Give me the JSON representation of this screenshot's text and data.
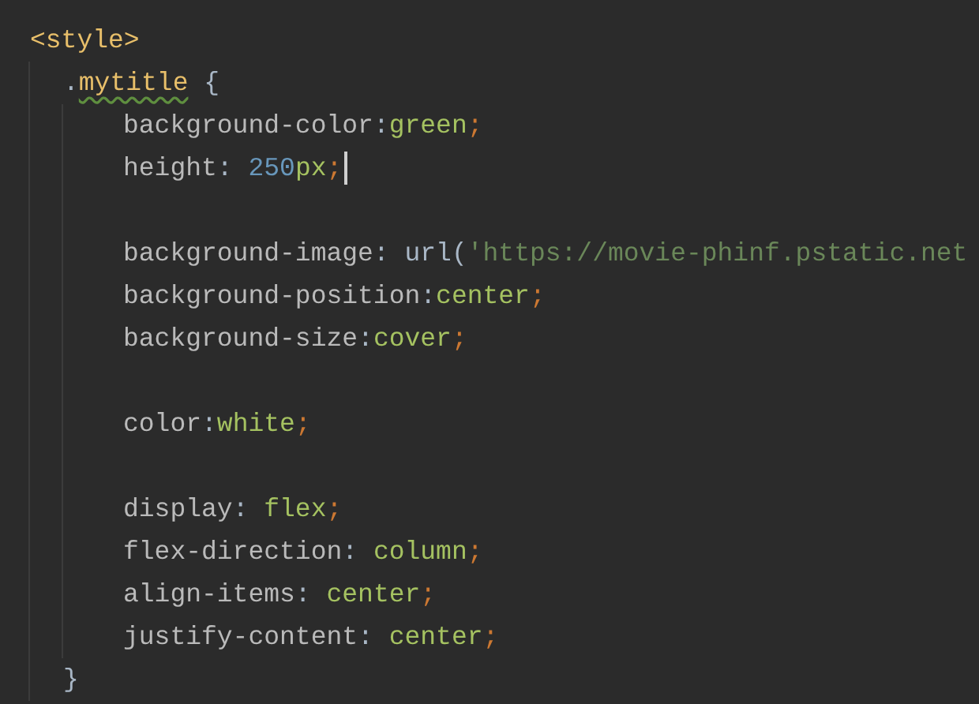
{
  "editor": {
    "lines": [
      {
        "kind": "code",
        "current": false,
        "tokens": [
          {
            "kind": "tag",
            "text": "<style>"
          }
        ],
        "children": [
          {
            "kind": "code",
            "current": false,
            "tokens": [
              {
                "kind": "punct",
                "text": "."
              },
              {
                "kind": "selector",
                "text": "mytitle",
                "warned": true
              },
              {
                "kind": "punct",
                "text": " {"
              }
            ],
            "children": [
              {
                "kind": "code",
                "current": false,
                "tokens": [
                  {
                    "kind": "property",
                    "text": "background-color"
                  },
                  {
                    "kind": "punct",
                    "text": ":"
                  },
                  {
                    "kind": "value",
                    "text": "green"
                  },
                  {
                    "kind": "semi",
                    "text": ";"
                  }
                ]
              },
              {
                "kind": "code",
                "current": true,
                "tokens": [
                  {
                    "kind": "property",
                    "text": "height"
                  },
                  {
                    "kind": "punct",
                    "text": ": "
                  },
                  {
                    "kind": "number",
                    "text": "250"
                  },
                  {
                    "kind": "value",
                    "text": "px"
                  },
                  {
                    "kind": "semi",
                    "text": ";"
                  }
                ]
              },
              {
                "kind": "blank"
              },
              {
                "kind": "code",
                "current": false,
                "tokens": [
                  {
                    "kind": "property",
                    "text": "background-image"
                  },
                  {
                    "kind": "punct",
                    "text": ": url("
                  },
                  {
                    "kind": "string",
                    "text": "'https://movie-phinf.pstatic.net"
                  }
                ]
              },
              {
                "kind": "code",
                "current": false,
                "tokens": [
                  {
                    "kind": "property",
                    "text": "background-position"
                  },
                  {
                    "kind": "punct",
                    "text": ":"
                  },
                  {
                    "kind": "value",
                    "text": "center"
                  },
                  {
                    "kind": "semi",
                    "text": ";"
                  }
                ]
              },
              {
                "kind": "code",
                "current": false,
                "tokens": [
                  {
                    "kind": "property",
                    "text": "background-size"
                  },
                  {
                    "kind": "punct",
                    "text": ":"
                  },
                  {
                    "kind": "value",
                    "text": "cover"
                  },
                  {
                    "kind": "semi",
                    "text": ";"
                  }
                ]
              },
              {
                "kind": "blank"
              },
              {
                "kind": "code",
                "current": false,
                "tokens": [
                  {
                    "kind": "property",
                    "text": "color"
                  },
                  {
                    "kind": "punct",
                    "text": ":"
                  },
                  {
                    "kind": "value",
                    "text": "white"
                  },
                  {
                    "kind": "semi",
                    "text": ";"
                  }
                ]
              },
              {
                "kind": "blank"
              },
              {
                "kind": "code",
                "current": false,
                "tokens": [
                  {
                    "kind": "property",
                    "text": "display"
                  },
                  {
                    "kind": "punct",
                    "text": ": "
                  },
                  {
                    "kind": "value",
                    "text": "flex"
                  },
                  {
                    "kind": "semi",
                    "text": ";"
                  }
                ]
              },
              {
                "kind": "code",
                "current": false,
                "tokens": [
                  {
                    "kind": "property",
                    "text": "flex-direction"
                  },
                  {
                    "kind": "punct",
                    "text": ": "
                  },
                  {
                    "kind": "value",
                    "text": "column"
                  },
                  {
                    "kind": "semi",
                    "text": ";"
                  }
                ]
              },
              {
                "kind": "code",
                "current": false,
                "tokens": [
                  {
                    "kind": "property",
                    "text": "align-items"
                  },
                  {
                    "kind": "punct",
                    "text": ": "
                  },
                  {
                    "kind": "value",
                    "text": "center"
                  },
                  {
                    "kind": "semi",
                    "text": ";"
                  }
                ]
              },
              {
                "kind": "code",
                "current": false,
                "tokens": [
                  {
                    "kind": "property",
                    "text": "justify-content"
                  },
                  {
                    "kind": "punct",
                    "text": ": "
                  },
                  {
                    "kind": "value",
                    "text": "center"
                  },
                  {
                    "kind": "semi",
                    "text": ";"
                  }
                ]
              }
            ]
          },
          {
            "kind": "code",
            "current": false,
            "tokens": [
              {
                "kind": "punct",
                "text": "}"
              }
            ]
          }
        ]
      }
    ]
  }
}
